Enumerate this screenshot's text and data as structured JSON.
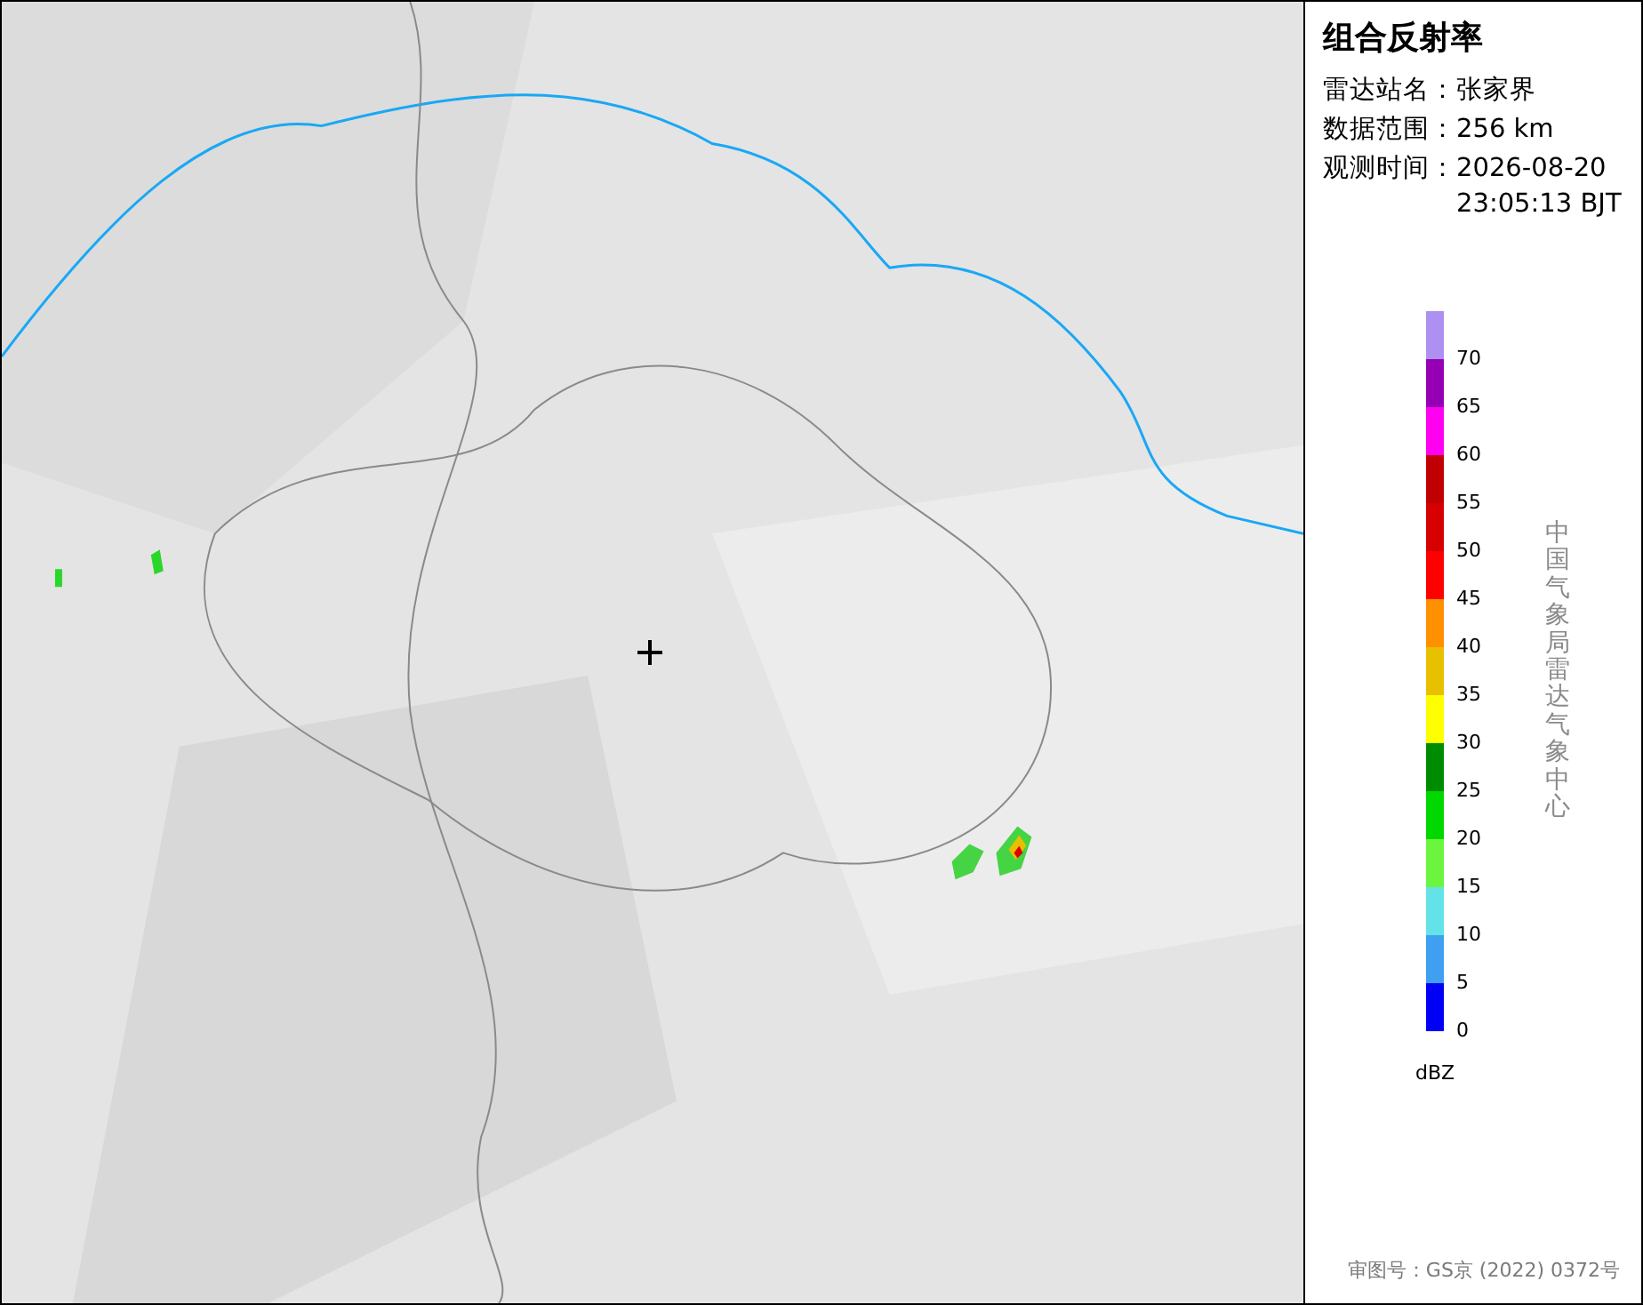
{
  "panel": {
    "title": "组合反射率",
    "info": [
      {
        "label": "雷达站名：",
        "values": [
          "张家界"
        ]
      },
      {
        "label": "数据范围：",
        "values": [
          "256 km"
        ]
      },
      {
        "label": "观测时间：",
        "values": [
          "2026-08-20",
          "23:05:13 BJT"
        ]
      }
    ],
    "legend": {
      "unit": "dBZ",
      "bins": [
        {
          "label": "70",
          "color": "#ad90f0"
        },
        {
          "label": "65",
          "color": "#9600b4"
        },
        {
          "label": "60",
          "color": "#ff00f0"
        },
        {
          "label": "55",
          "color": "#c00000"
        },
        {
          "label": "50",
          "color": "#d60000"
        },
        {
          "label": "45",
          "color": "#ff0000"
        },
        {
          "label": "40",
          "color": "#ff9000"
        },
        {
          "label": "35",
          "color": "#e7c000"
        },
        {
          "label": "30",
          "color": "#ffff00"
        },
        {
          "label": "25",
          "color": "#008c00"
        },
        {
          "label": "20",
          "color": "#00d800"
        },
        {
          "label": "15",
          "color": "#6cf53f"
        },
        {
          "label": "10",
          "color": "#63e3e8"
        },
        {
          "label": "5",
          "color": "#3f9ff0"
        },
        {
          "label": "0",
          "color": "#0000f6"
        }
      ]
    },
    "credit": "中国气象局雷达气象中心",
    "approval": "审图号：GS京 (2022) 0372号"
  }
}
